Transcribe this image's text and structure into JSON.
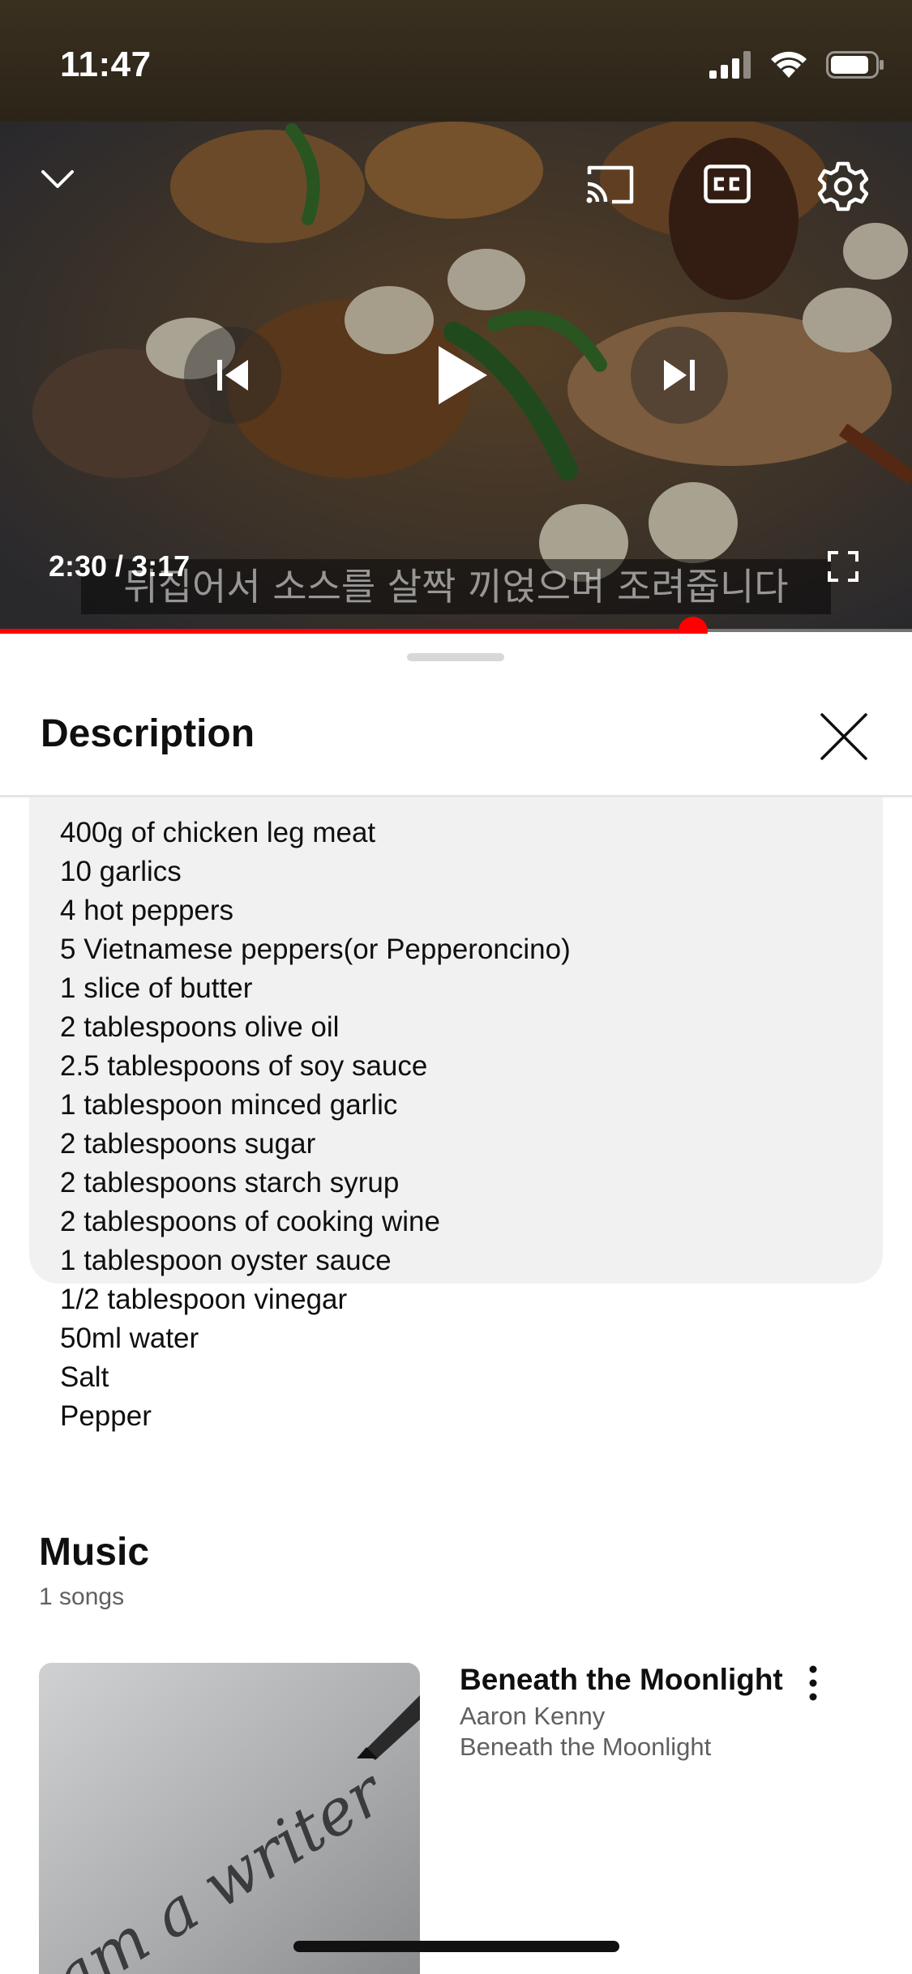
{
  "status_bar": {
    "time": "11:47",
    "icons": [
      "cellular-signal-icon",
      "wifi-icon",
      "battery-icon"
    ]
  },
  "player": {
    "subtitle": "뒤집어서 소스를 살짝 끼얹으며 조려줍니다",
    "current_time": "2:30",
    "duration": "3:17",
    "time_display": "2:30 / 3:17",
    "progress_fraction": 0.76,
    "controls": [
      "collapse-icon",
      "cast-icon",
      "closed-captions-icon",
      "settings-icon",
      "previous-icon",
      "play-icon",
      "next-icon",
      "fullscreen-icon"
    ],
    "accent_color": "#ff0000"
  },
  "description": {
    "title": "Description",
    "ingredients": [
      "400g of chicken leg meat",
      "10 garlics",
      "4 hot peppers",
      "5 Vietnamese peppers(or Pepperoncino)",
      "1 slice of butter",
      "2 tablespoons olive oil",
      "2.5 tablespoons of soy sauce",
      "1 tablespoon minced garlic",
      "2 tablespoons sugar",
      "2 tablespoons starch syrup",
      "2 tablespoons of cooking wine",
      "1 tablespoon oyster sauce",
      "1/2 tablespoon vinegar",
      "50ml water",
      "Salt",
      "Pepper"
    ]
  },
  "music": {
    "title": "Music",
    "count": "1 songs",
    "songs": [
      {
        "title": "Beneath the Moonlight",
        "artist": "Aaron Kenny",
        "album": "Beneath the Moonlight",
        "thumbnail_text": "am a writer"
      }
    ]
  }
}
